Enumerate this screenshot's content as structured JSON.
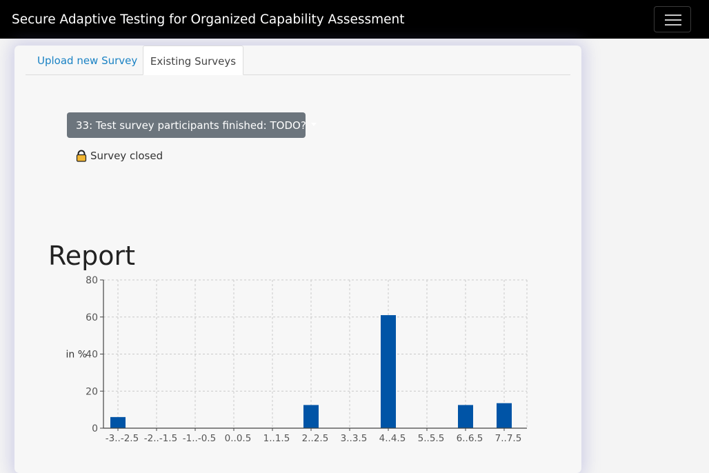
{
  "navbar": {
    "title": "Secure Adaptive Testing for Organized Capability Assessment",
    "menu_icon": "hamburger-menu-icon"
  },
  "tabs": [
    {
      "label": "Upload new Survey",
      "active": false
    },
    {
      "label": "Existing Surveys",
      "active": true
    }
  ],
  "survey_select": {
    "selected": "33: Test survey participants finished: TODO?"
  },
  "status": {
    "icon": "lock-icon",
    "text": "Survey closed"
  },
  "report": {
    "title": "Report"
  },
  "colors": {
    "navbar_bg": "#000000",
    "link": "#1a82c4",
    "dropdown_bg": "#6c757d",
    "bar": "#0054a6"
  },
  "chart_data": {
    "type": "bar",
    "categories": [
      "-3..-2.5",
      "-2..-1.5",
      "-1..-0.5",
      "0..0.5",
      "1..1.5",
      "2..2.5",
      "3..3.5",
      "4..4.5",
      "5..5.5",
      "6..6.5",
      "7..7.5"
    ],
    "values": [
      6,
      0,
      0,
      0,
      0,
      12.5,
      0,
      61,
      0,
      12.5,
      13.5
    ],
    "ylabel": "in %",
    "ylim": [
      0,
      80
    ],
    "yticks": [
      0,
      20,
      40,
      60,
      80
    ],
    "grid": true
  }
}
